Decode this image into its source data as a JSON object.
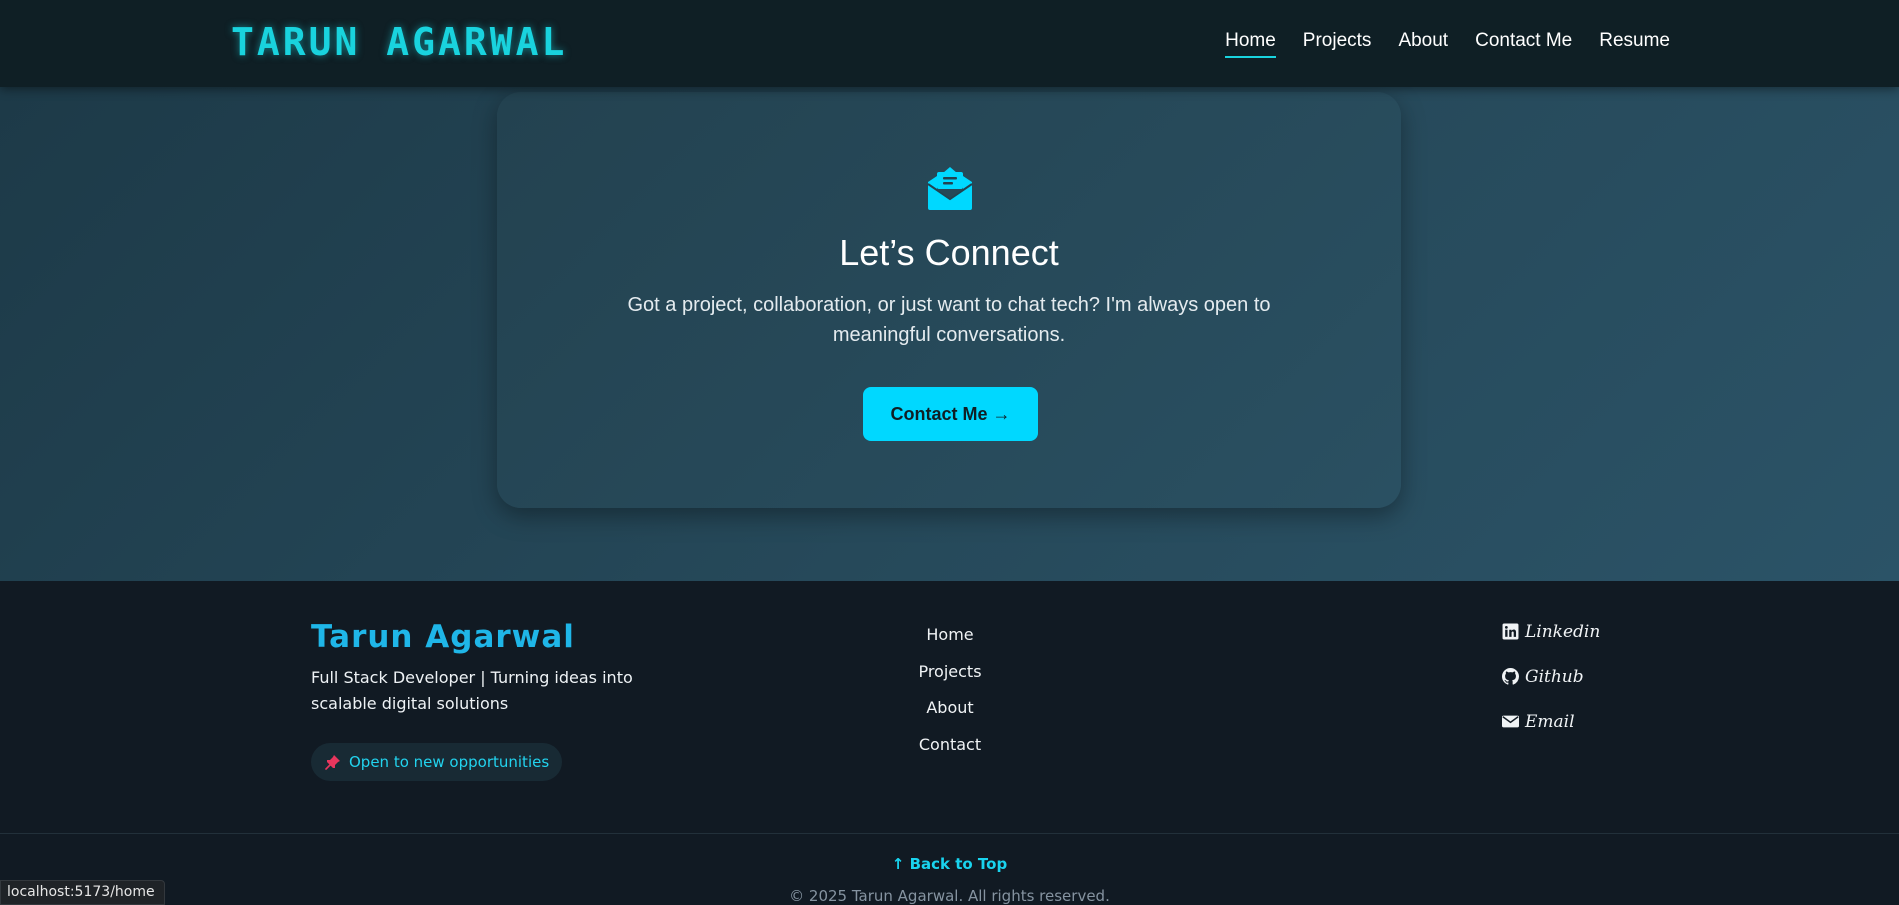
{
  "header": {
    "brand": "TARUN AGARWAL",
    "nav": [
      {
        "label": "Home",
        "active": true
      },
      {
        "label": "Projects"
      },
      {
        "label": "About"
      },
      {
        "label": "Contact Me"
      },
      {
        "label": "Resume"
      }
    ]
  },
  "hero": {
    "icon": "open-envelope-icon",
    "title": "Let’s Connect",
    "description": "Got a project, collaboration, or just want to chat tech? I'm always open to meaningful conversations.",
    "button_label": "Contact Me →"
  },
  "footer": {
    "name": "Tarun Agarwal",
    "tagline": "Full Stack Developer | Turning ideas into scalable digital solutions",
    "badge": {
      "icon": "pushpin-icon",
      "label": "Open to new opportunities"
    },
    "links": [
      "Home",
      "Projects",
      "About",
      "Contact"
    ],
    "social": [
      {
        "icon": "linkedin-icon",
        "label": "Linkedin"
      },
      {
        "icon": "github-icon",
        "label": "Github"
      },
      {
        "icon": "envelope-icon",
        "label": "Email"
      }
    ],
    "back_to_top": "↑ Back to Top",
    "copyright": "© 2025 Tarun Agarwal. All rights reserved."
  },
  "status_bar": {
    "url": "localhost:5173/home"
  },
  "colors": {
    "accent": "#19d3de",
    "button": "#00d8ff",
    "footer_name": "#1fb6e8",
    "header_bg": "#0f1f25",
    "footer_bg": "#111a23"
  }
}
